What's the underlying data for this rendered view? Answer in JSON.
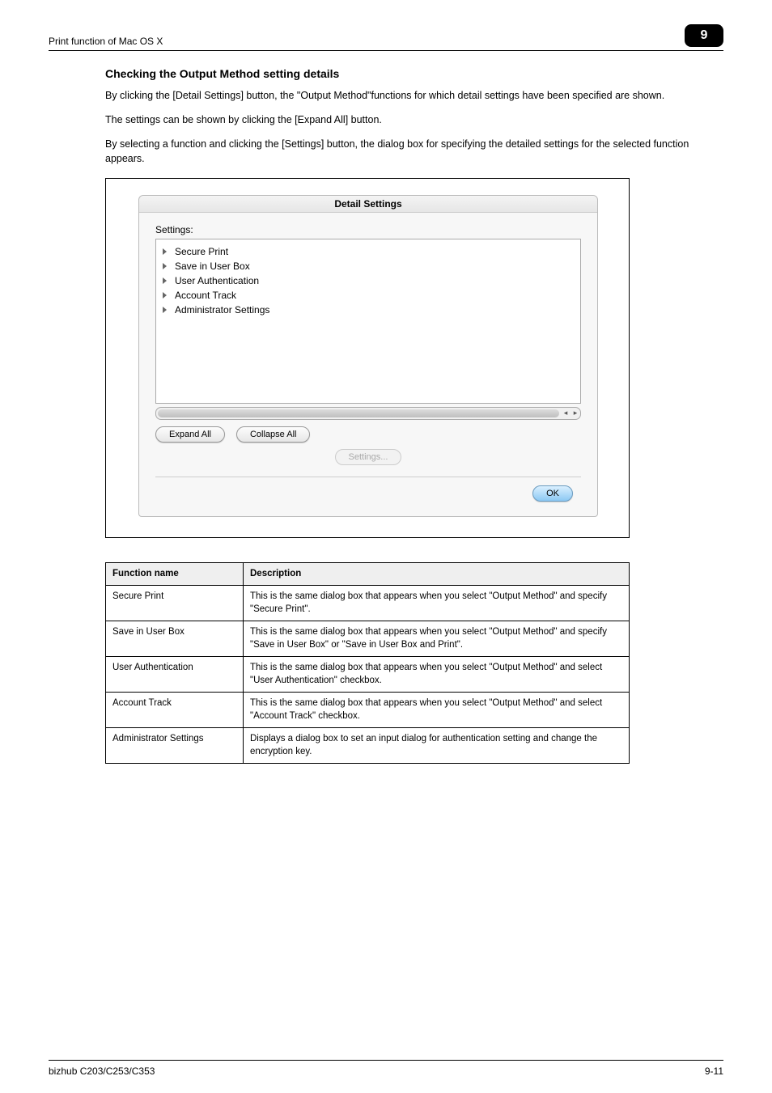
{
  "header": {
    "left": "Print function of Mac OS X",
    "badge": "9"
  },
  "section": {
    "heading": "Checking the Output Method setting details",
    "p1": "By clicking the [Detail Settings] button, the \"Output Method\"functions for which detail settings have been specified are shown.",
    "p2": "The settings can be shown by clicking the [Expand All] button.",
    "p3": "By selecting a function and clicking the [Settings] button, the dialog box for specifying the detailed settings for the selected function appears."
  },
  "dialog": {
    "title": "Detail Settings",
    "list_label": "Settings:",
    "items": [
      "Secure Print",
      "Save in User Box",
      "User Authentication",
      "Account Track",
      "Administrator Settings"
    ],
    "expand_btn": "Expand All",
    "collapse_btn": "Collapse All",
    "settings_btn": "Settings...",
    "ok_btn": "OK"
  },
  "table": {
    "headers": [
      "Function name",
      "Description"
    ],
    "rows": [
      {
        "name": "Secure Print",
        "desc": "This is the same dialog box that appears when you select \"Output Method\" and specify \"Secure Print\"."
      },
      {
        "name": "Save in User Box",
        "desc": "This is the same dialog box that appears when you select \"Output Method\" and specify \"Save in User Box\" or \"Save in User Box and Print\"."
      },
      {
        "name": "User Authentication",
        "desc": "This is the same dialog box that appears when you select \"Output Method\" and select \"User Authentication\" checkbox."
      },
      {
        "name": "Account Track",
        "desc": "This is the same dialog box that appears when you select \"Output Method\" and select \"Account Track\" checkbox."
      },
      {
        "name": "Administrator Settings",
        "desc": "Displays a dialog box to set an input dialog for authentication setting and change the encryption key."
      }
    ]
  },
  "footer": {
    "left": "bizhub C203/C253/C353",
    "right": "9-11"
  }
}
